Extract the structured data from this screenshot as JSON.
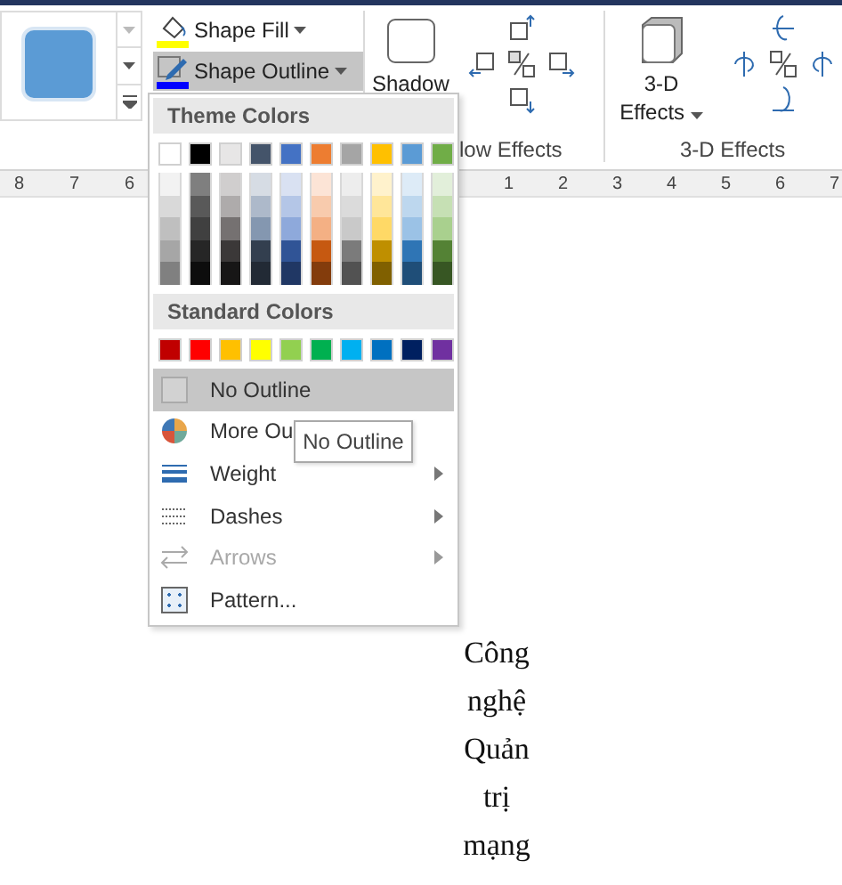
{
  "ribbon": {
    "fill_button": {
      "label": "Shape Fill",
      "color": "#ffff00"
    },
    "outline_button": {
      "label": "Shape Outline",
      "color": "#0000ff",
      "selected": true
    },
    "shadow_button": {
      "label": "Shadow"
    },
    "shadow_group_label": "low Effects",
    "effects_button": {
      "line_1": "3-D",
      "line_2": "Effects"
    },
    "effects_group_label": "3-D Effects"
  },
  "ruler": {
    "left_numbers": [
      "8",
      "7",
      "6"
    ],
    "right_numbers": [
      "1",
      "2",
      "3",
      "4",
      "5",
      "6",
      "7"
    ]
  },
  "menu": {
    "theme_title": "Theme Colors",
    "theme_colors": [
      {
        "color": "#ffffff"
      },
      {
        "color": "#000000"
      },
      {
        "color": "#e7e6e6"
      },
      {
        "color": "#44546a"
      },
      {
        "color": "#4472c4"
      },
      {
        "color": "#ed7d31"
      },
      {
        "color": "#a5a5a5"
      },
      {
        "color": "#ffc000"
      },
      {
        "color": "#5b9bd5"
      },
      {
        "color": "#70ad47"
      }
    ],
    "theme_shades": [
      {
        "shades": [
          {
            "color": "#f2f2f2"
          },
          {
            "color": "#d9d9d9"
          },
          {
            "color": "#bfbfbf"
          },
          {
            "color": "#a6a6a6"
          },
          {
            "color": "#808080"
          }
        ]
      },
      {
        "shades": [
          {
            "color": "#7f7f7f"
          },
          {
            "color": "#595959"
          },
          {
            "color": "#404040"
          },
          {
            "color": "#262626"
          },
          {
            "color": "#0d0d0d"
          }
        ]
      },
      {
        "shades": [
          {
            "color": "#d0cece"
          },
          {
            "color": "#aeabab"
          },
          {
            "color": "#757171"
          },
          {
            "color": "#3b3838"
          },
          {
            "color": "#171616"
          }
        ]
      },
      {
        "shades": [
          {
            "color": "#d6dce4"
          },
          {
            "color": "#adb9ca"
          },
          {
            "color": "#8497b0"
          },
          {
            "color": "#333f4f"
          },
          {
            "color": "#222a35"
          }
        ]
      },
      {
        "shades": [
          {
            "color": "#d9e1f2"
          },
          {
            "color": "#b4c6e7"
          },
          {
            "color": "#8ea9db"
          },
          {
            "color": "#305496"
          },
          {
            "color": "#203764"
          }
        ]
      },
      {
        "shades": [
          {
            "color": "#fce4d6"
          },
          {
            "color": "#f8cbad"
          },
          {
            "color": "#f4b084"
          },
          {
            "color": "#c65911"
          },
          {
            "color": "#833c0c"
          }
        ]
      },
      {
        "shades": [
          {
            "color": "#ededed"
          },
          {
            "color": "#dbdbdb"
          },
          {
            "color": "#c9c9c9"
          },
          {
            "color": "#7b7b7b"
          },
          {
            "color": "#525252"
          }
        ]
      },
      {
        "shades": [
          {
            "color": "#fff2cc"
          },
          {
            "color": "#ffe699"
          },
          {
            "color": "#ffd966"
          },
          {
            "color": "#bf8f00"
          },
          {
            "color": "#806000"
          }
        ]
      },
      {
        "shades": [
          {
            "color": "#ddebf7"
          },
          {
            "color": "#bdd7ee"
          },
          {
            "color": "#9bc2e6"
          },
          {
            "color": "#2f75b5"
          },
          {
            "color": "#1f4e78"
          }
        ]
      },
      {
        "shades": [
          {
            "color": "#e2efda"
          },
          {
            "color": "#c6e0b4"
          },
          {
            "color": "#a9d08e"
          },
          {
            "color": "#548235"
          },
          {
            "color": "#375623"
          }
        ]
      }
    ],
    "standard_title": "Standard Colors",
    "standard_colors": [
      {
        "color": "#c00000"
      },
      {
        "color": "#ff0000"
      },
      {
        "color": "#ffc000"
      },
      {
        "color": "#ffff00"
      },
      {
        "color": "#92d050"
      },
      {
        "color": "#00b050"
      },
      {
        "color": "#00b0f0"
      },
      {
        "color": "#0070c0"
      },
      {
        "color": "#002060"
      },
      {
        "color": "#7030a0"
      }
    ],
    "items": [
      {
        "kind": "swatch",
        "label": "No Outline",
        "selected": true,
        "disabled": false,
        "submenu": false
      },
      {
        "kind": "palette",
        "label": "More Ou",
        "selected": false,
        "disabled": false,
        "submenu": false
      },
      {
        "kind": "weight",
        "label": "Weight",
        "selected": false,
        "disabled": false,
        "submenu": true
      },
      {
        "kind": "dashes",
        "label": "Dashes",
        "selected": false,
        "disabled": false,
        "submenu": true
      },
      {
        "kind": "arrows",
        "label": "Arrows",
        "selected": false,
        "disabled": true,
        "submenu": true
      },
      {
        "kind": "pattern",
        "label": "Pattern...",
        "selected": false,
        "disabled": false,
        "submenu": false
      }
    ]
  },
  "tooltip": {
    "text": "No Outline"
  },
  "document": {
    "lines": [
      "Công",
      "nghệ",
      "Quản",
      "trị",
      "mạng"
    ]
  }
}
